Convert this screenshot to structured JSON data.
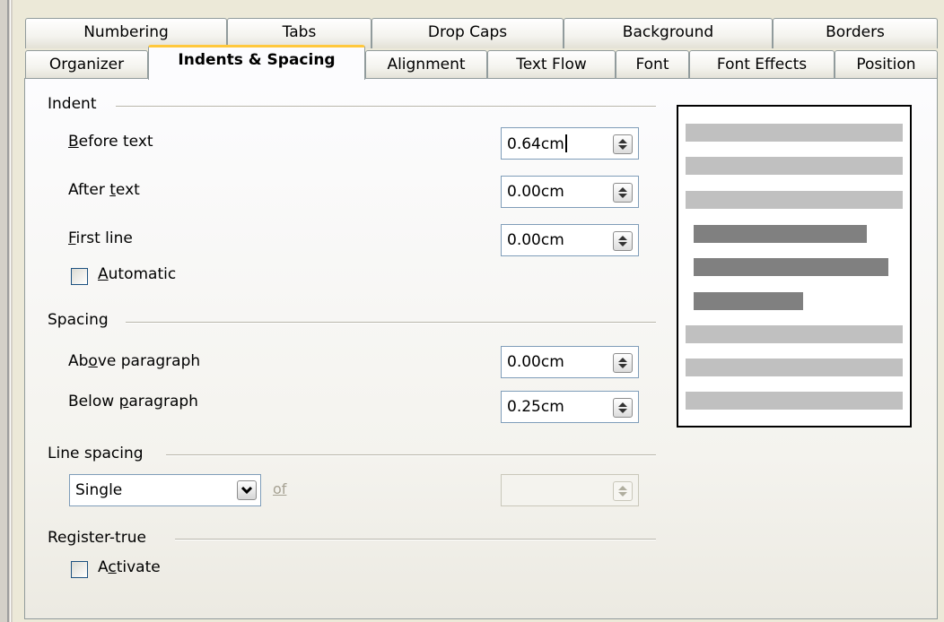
{
  "tabs_row1": [
    "Numbering",
    "Tabs",
    "Drop Caps",
    "Background",
    "Borders"
  ],
  "tabs_row2": [
    "Organizer",
    "Indents & Spacing",
    "Alignment",
    "Text Flow",
    "Font",
    "Font Effects",
    "Position"
  ],
  "active_tab": "Indents & Spacing",
  "indent": {
    "heading": "Indent",
    "before_text": {
      "label_u": "B",
      "label_rest": "efore text",
      "value": "0.64cm"
    },
    "after_text": {
      "label_pre": "After ",
      "label_u": "t",
      "label_rest": "ext",
      "value": "0.00cm"
    },
    "first_line": {
      "label_u": "F",
      "label_rest": "irst line",
      "value": "0.00cm"
    },
    "automatic": {
      "label_u": "A",
      "label_rest": "utomatic",
      "checked": false
    }
  },
  "spacing": {
    "heading": "Spacing",
    "above": {
      "label_pre": "Ab",
      "label_u": "o",
      "label_rest": "ve paragraph",
      "value": "0.00cm"
    },
    "below": {
      "label_pre": "Below ",
      "label_u": "p",
      "label_rest": "aragraph",
      "value": "0.25cm"
    }
  },
  "line_spacing": {
    "heading": "Line spacing",
    "selected": "Single",
    "of_label": "of",
    "of_value": ""
  },
  "register_true": {
    "heading": "Register-true",
    "activate": {
      "label_pre": "A",
      "label_u": "c",
      "label_rest": "tivate",
      "checked": false
    }
  },
  "colors": {
    "active_tab_accent": "#ffc83c",
    "preview_light": "#c0c0c0",
    "preview_dark": "#808080"
  },
  "icons": [
    "spin-up-down-icon",
    "chevron-down-icon"
  ]
}
